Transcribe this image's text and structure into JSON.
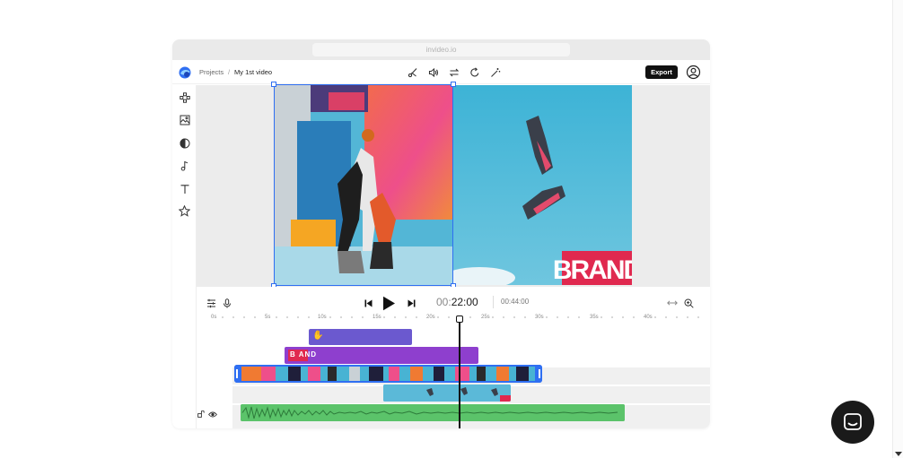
{
  "browser": {
    "url": "invideo.io"
  },
  "header": {
    "breadcrumb_projects": "Projects",
    "breadcrumb_separator": "/",
    "project_title": "My 1st video",
    "export_label": "Export"
  },
  "toolbar_icons": [
    "cut-icon",
    "volume-icon",
    "swap-icon",
    "rotate-icon",
    "magic-wand-icon"
  ],
  "sidebar_icons": [
    "elements-icon",
    "media-icon",
    "color-icon",
    "music-icon",
    "text-icon",
    "star-icon"
  ],
  "canvas": {
    "brand_text": "BRAND"
  },
  "timeline": {
    "current_time_dim": "00:",
    "current_time_main": "22:00",
    "total_time": "00:44:00",
    "ruler_labels": [
      "0s",
      "5s",
      "10s",
      "15s",
      "20s",
      "25s",
      "30s",
      "35s",
      "40s"
    ],
    "brand_clip_label": "B AND",
    "sticker_clip_label": "✋"
  },
  "colors": {
    "accent": "#2f6ff2",
    "sticker_clip": "#6b59cf",
    "brand_clip": "#8e3fce",
    "audio_clip": "#5bc36a",
    "overlay_clip": "#46a5c8",
    "export_button": "#111111"
  }
}
